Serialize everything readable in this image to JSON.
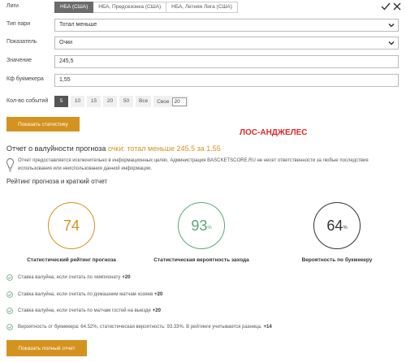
{
  "leagues": {
    "label": "Лиги",
    "tabs": [
      "НБА (США)",
      "НБА, Предсезонка (США)",
      "НБА, Летняя Лига (США)"
    ],
    "active_index": 0
  },
  "form": {
    "pair_type": {
      "label": "Тип пари",
      "value": "Тотал меньше"
    },
    "indicator": {
      "label": "Показатель",
      "value": "Очки"
    },
    "value": {
      "label": "Значение",
      "value": "245,5"
    },
    "odds": {
      "label": "Кф букмекера",
      "value": "1,55"
    },
    "events": {
      "label": "Кол-во событий",
      "options": [
        "5",
        "10",
        "15",
        "20",
        "50",
        "Все"
      ],
      "active_index": 0,
      "own_label": "Свое",
      "own_value": "20"
    }
  },
  "team_name": "ЛОС-АНДЖЕЛЕС",
  "show_stats_button": "Показать статистику",
  "report": {
    "title_prefix": "Отчет о валуйности прогноза",
    "title_accent": "очки: тотал меньше 245.5 за 1.55",
    "disclaimer": "Отчет предоставляется исключительно в информационных целях. Администрация BASCKETSCORE.RU не несет ответственности за любые последствия использования или неиспользования данной информации.",
    "rating_title": "Рейтинг прогноза и краткий отчет"
  },
  "gauges": [
    {
      "value": "74",
      "suffix": "",
      "label": "Статистический рейтинг прогноза",
      "color": "#d4921f"
    },
    {
      "value": "93",
      "suffix": "%",
      "label": "Статистическая вероятность захода",
      "color": "#5aa878"
    },
    {
      "value": "64",
      "suffix": "%",
      "label": "Вероятность по букмекеру",
      "color": "#333333"
    }
  ],
  "checks": [
    {
      "text": "Ставка валуйна, если считать по чемпионату",
      "bonus": "+20"
    },
    {
      "text": "Ставка валуйна, если считать по домашним матчам хозяев",
      "bonus": "+20"
    },
    {
      "text": "Ставка валуйна, если считать по матчам гостей на выезде",
      "bonus": "+20"
    },
    {
      "text": "Вероятность от букмекера: 64.52%, статистическая вероятность: 93.33%. В рейтинге учитывается разница.",
      "bonus": "+14"
    }
  ],
  "full_report_button": "Показать полный отчет",
  "colors": {
    "accent": "#d4921f",
    "green": "#5aa878",
    "team": "#e0282b",
    "active_tab": "#6b6b6b"
  }
}
